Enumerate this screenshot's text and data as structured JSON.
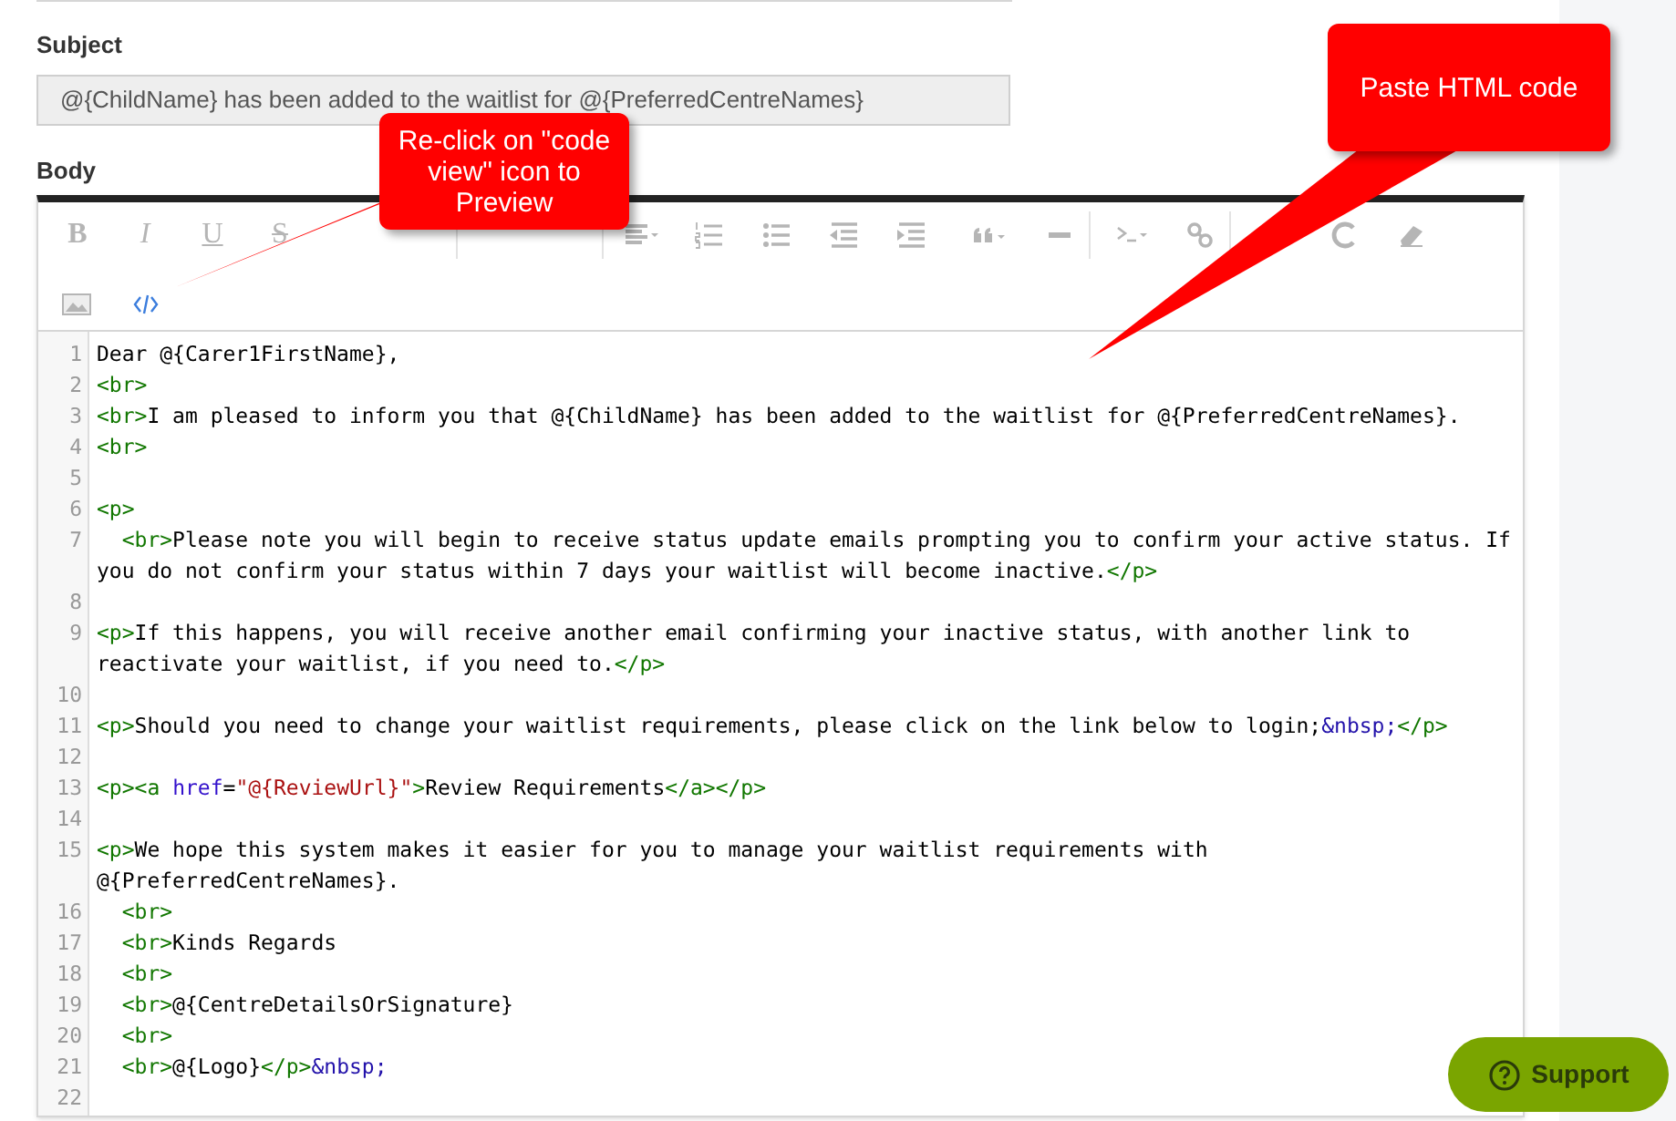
{
  "subject": {
    "label": "Subject",
    "value": "@{ChildName} has been added to the waitlist for @{PreferredCentreNames}"
  },
  "body": {
    "label": "Body"
  },
  "toolbar": [
    {
      "kind": "bold",
      "label": "B",
      "selected": false
    },
    {
      "kind": "italic",
      "label": "I",
      "selected": false
    },
    {
      "kind": "underline",
      "label": "U",
      "selected": false
    },
    {
      "kind": "strike",
      "label": "S",
      "selected": false
    },
    {
      "kind": "separator"
    },
    {
      "kind": "separator"
    },
    {
      "kind": "align",
      "selected": false
    },
    {
      "kind": "ordered-list",
      "selected": false
    },
    {
      "kind": "bullet-list",
      "selected": false
    },
    {
      "kind": "outdent",
      "selected": false
    },
    {
      "kind": "indent",
      "selected": false
    },
    {
      "kind": "quote",
      "selected": false
    },
    {
      "kind": "rule",
      "selected": false
    },
    {
      "kind": "separator"
    },
    {
      "kind": "terminal",
      "selected": false
    },
    {
      "kind": "link",
      "selected": false
    },
    {
      "kind": "separator"
    },
    {
      "kind": "redo",
      "selected": false
    },
    {
      "kind": "eraser",
      "selected": false
    },
    {
      "kind": "break"
    },
    {
      "kind": "image",
      "selected": false
    },
    {
      "kind": "code-view",
      "selected": true
    }
  ],
  "code_lines": [
    {
      "number": "1",
      "segments": [
        {
          "kind": "text",
          "text": "Dear @{Carer1FirstName},"
        }
      ]
    },
    {
      "number": "2",
      "segments": [
        {
          "kind": "tag",
          "text": "<br>"
        }
      ]
    },
    {
      "number": "3",
      "segments": [
        {
          "kind": "tag",
          "text": "<br>"
        },
        {
          "kind": "text",
          "text": "I am pleased to inform you that @{ChildName} has been added to the waitlist for @{PreferredCentreNames}."
        }
      ]
    },
    {
      "number": "4",
      "segments": [
        {
          "kind": "tag",
          "text": "<br>"
        }
      ]
    },
    {
      "number": "5"
    },
    {
      "number": "6",
      "segments": [
        {
          "kind": "tag",
          "text": "<p>"
        }
      ]
    },
    {
      "number": "7",
      "indent": true,
      "segments": [
        {
          "kind": "tag",
          "text": "<br>"
        },
        {
          "kind": "text",
          "text": "Please note you will begin to receive status update emails prompting you to confirm your active status. If you do not confirm your status within 7 days your waitlist will become inactive."
        },
        {
          "kind": "tag",
          "text": "</p>"
        }
      ]
    },
    {
      "number": "8"
    },
    {
      "number": "9",
      "segments": [
        {
          "kind": "tag",
          "text": "<p>"
        },
        {
          "kind": "text",
          "text": "If this happens, you will receive another email confirming your inactive status, with another link to reactivate your waitlist, if you need to."
        },
        {
          "kind": "tag",
          "text": "</p>"
        }
      ]
    },
    {
      "number": "10"
    },
    {
      "number": "11",
      "segments": [
        {
          "kind": "tag",
          "text": "<p>"
        },
        {
          "kind": "text",
          "text": "Should you need to change your waitlist requirements, please click on the link below to login;"
        },
        {
          "kind": "entity",
          "text": "&nbsp;"
        },
        {
          "kind": "tag",
          "text": "</p>"
        }
      ]
    },
    {
      "number": "12"
    },
    {
      "number": "13",
      "segments": [
        {
          "kind": "tag",
          "text": "<p><a"
        },
        {
          "kind": "attr",
          "text": "href"
        },
        {
          "kind": "text",
          "text": "="
        },
        {
          "kind": "string",
          "text": "\"@{ReviewUrl}\""
        },
        {
          "kind": "tag",
          "text": ">"
        },
        {
          "kind": "text",
          "text": "Review Requirements"
        },
        {
          "kind": "tag",
          "text": "</a></p>"
        }
      ]
    },
    {
      "number": "14"
    },
    {
      "number": "15",
      "segments": [
        {
          "kind": "tag",
          "text": "<p>"
        },
        {
          "kind": "text",
          "text": "We hope this system makes it easier for you to manage your waitlist requirements with @{PreferredCentreNames}."
        }
      ]
    },
    {
      "number": "16",
      "indent": true,
      "segments": [
        {
          "kind": "tag",
          "text": "<br>"
        }
      ]
    },
    {
      "number": "17",
      "indent": true,
      "segments": [
        {
          "kind": "tag",
          "text": "<br>"
        },
        {
          "kind": "text",
          "text": "Kinds Regards"
        }
      ]
    },
    {
      "number": "18",
      "indent": true,
      "segments": [
        {
          "kind": "tag",
          "text": "<br>"
        }
      ]
    },
    {
      "number": "19",
      "indent": true,
      "segments": [
        {
          "kind": "tag",
          "text": "<br>"
        },
        {
          "kind": "text",
          "text": "@{CentreDetailsOrSignature}"
        }
      ]
    },
    {
      "number": "20",
      "indent": true,
      "segments": [
        {
          "kind": "tag",
          "text": "<br>"
        }
      ]
    },
    {
      "number": "21",
      "indent": true,
      "segments": [
        {
          "kind": "tag",
          "text": "<br>"
        },
        {
          "kind": "text",
          "text": "@{Logo}"
        },
        {
          "kind": "tag",
          "text": "</p>"
        },
        {
          "kind": "entity",
          "text": "&nbsp;"
        }
      ]
    },
    {
      "number": "22"
    }
  ],
  "annotations": [
    {
      "text": "Re-click on \"code view\" icon to Preview"
    },
    {
      "text": "Paste HTML code"
    }
  ],
  "support_button": {
    "label": "Support"
  }
}
